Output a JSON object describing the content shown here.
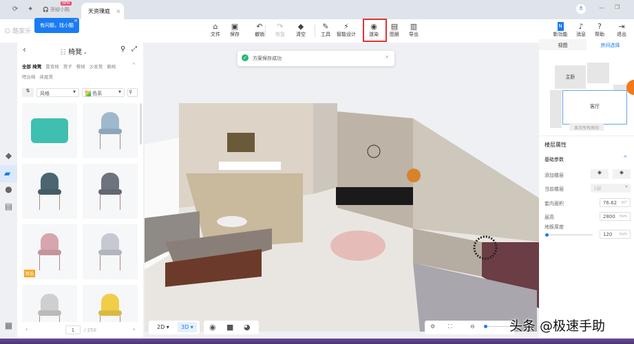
{
  "tabs": {
    "support_label": "答疑小酷",
    "support_badge": "NEW",
    "active_label": "天资璞庭",
    "close": "×"
  },
  "tooltip": {
    "text": "有问题，找小酷",
    "close": "×"
  },
  "logo": "酷家乐",
  "toolbar": {
    "items": [
      {
        "label": "文件",
        "icon": "file-icon",
        "glyph": "⌂"
      },
      {
        "label": "保存",
        "icon": "save-icon",
        "glyph": "▣"
      },
      {
        "label": "撤销",
        "icon": "undo-icon",
        "glyph": "↶"
      },
      {
        "label": "恢复",
        "icon": "redo-icon",
        "glyph": "↷",
        "disabled": true
      },
      {
        "label": "清空",
        "icon": "eraser-icon",
        "glyph": "◆"
      },
      {
        "label": "工具",
        "icon": "wrench-icon",
        "glyph": "✎"
      },
      {
        "label": "智能设计",
        "icon": "lightning-icon",
        "glyph": "⚡"
      },
      {
        "label": "渲染",
        "icon": "camera-icon",
        "glyph": "◉",
        "highlighted": true
      },
      {
        "label": "图册",
        "icon": "album-icon",
        "glyph": "▤"
      },
      {
        "label": "导出",
        "icon": "export-icon",
        "glyph": "▥"
      }
    ],
    "right": [
      {
        "label": "新功能",
        "icon": "new-feature-icon",
        "glyph": "N"
      },
      {
        "label": "消息",
        "icon": "bell-icon",
        "glyph": "♪"
      },
      {
        "label": "帮助",
        "icon": "help-icon",
        "glyph": "?"
      },
      {
        "label": "退出",
        "icon": "logout-icon",
        "glyph": "⇥"
      }
    ]
  },
  "toast": {
    "text": "方案保存成功",
    "close": "×"
  },
  "catalog": {
    "title": "椅凳",
    "categories_row1": [
      "全部 椅凳",
      "靠背椅",
      "凳子",
      "餐椅",
      "沙发凳",
      "躺椅"
    ],
    "categories_row2": [
      "吧台椅",
      "床尾凳"
    ],
    "filter_style": "风格",
    "filter_color": "色系",
    "items": [
      {
        "name": "ottoman",
        "color": "#3fbfb0"
      },
      {
        "name": "blue-chair",
        "color": "#9fb8cc"
      },
      {
        "name": "teal-armchair",
        "color": "#4b6670"
      },
      {
        "name": "gray-chair",
        "color": "#6f737d"
      },
      {
        "name": "pink-chair",
        "color": "#d7a5ae",
        "badge": "精选"
      },
      {
        "name": "light-gray-chair",
        "color": "#c6c9d2"
      },
      {
        "name": "office-chair",
        "color": "#cfcfcf"
      },
      {
        "name": "yellow-chair",
        "color": "#f1cd4a"
      }
    ],
    "page": "1",
    "total": "/ 250"
  },
  "right_panel": {
    "tab_view": "视图",
    "tab_room": "房间选择",
    "rooms": [
      "主卧",
      "客厅"
    ],
    "show_all": "显示所有房间",
    "floor_title": "楼层属性",
    "section": "基础参数",
    "add_floor": "添加楼层",
    "current_floor": "当前楼层",
    "current_floor_value": "1层",
    "area_label": "套内面积",
    "area_value": "76.62",
    "area_unit": "m²",
    "height_label": "层高",
    "height_value": "2800",
    "height_unit": "mm",
    "thickness_label": "地板厚度",
    "thickness_value": "120",
    "thickness_unit": "mm",
    "thickness_slider": 0.02
  },
  "view": {
    "mode_2d": "2D",
    "mode_3d": "3D",
    "active": "3D"
  },
  "watermark": "头条 @极速手助",
  "colors": {
    "accent": "#1a7cf2",
    "highlight": "#e03131"
  }
}
